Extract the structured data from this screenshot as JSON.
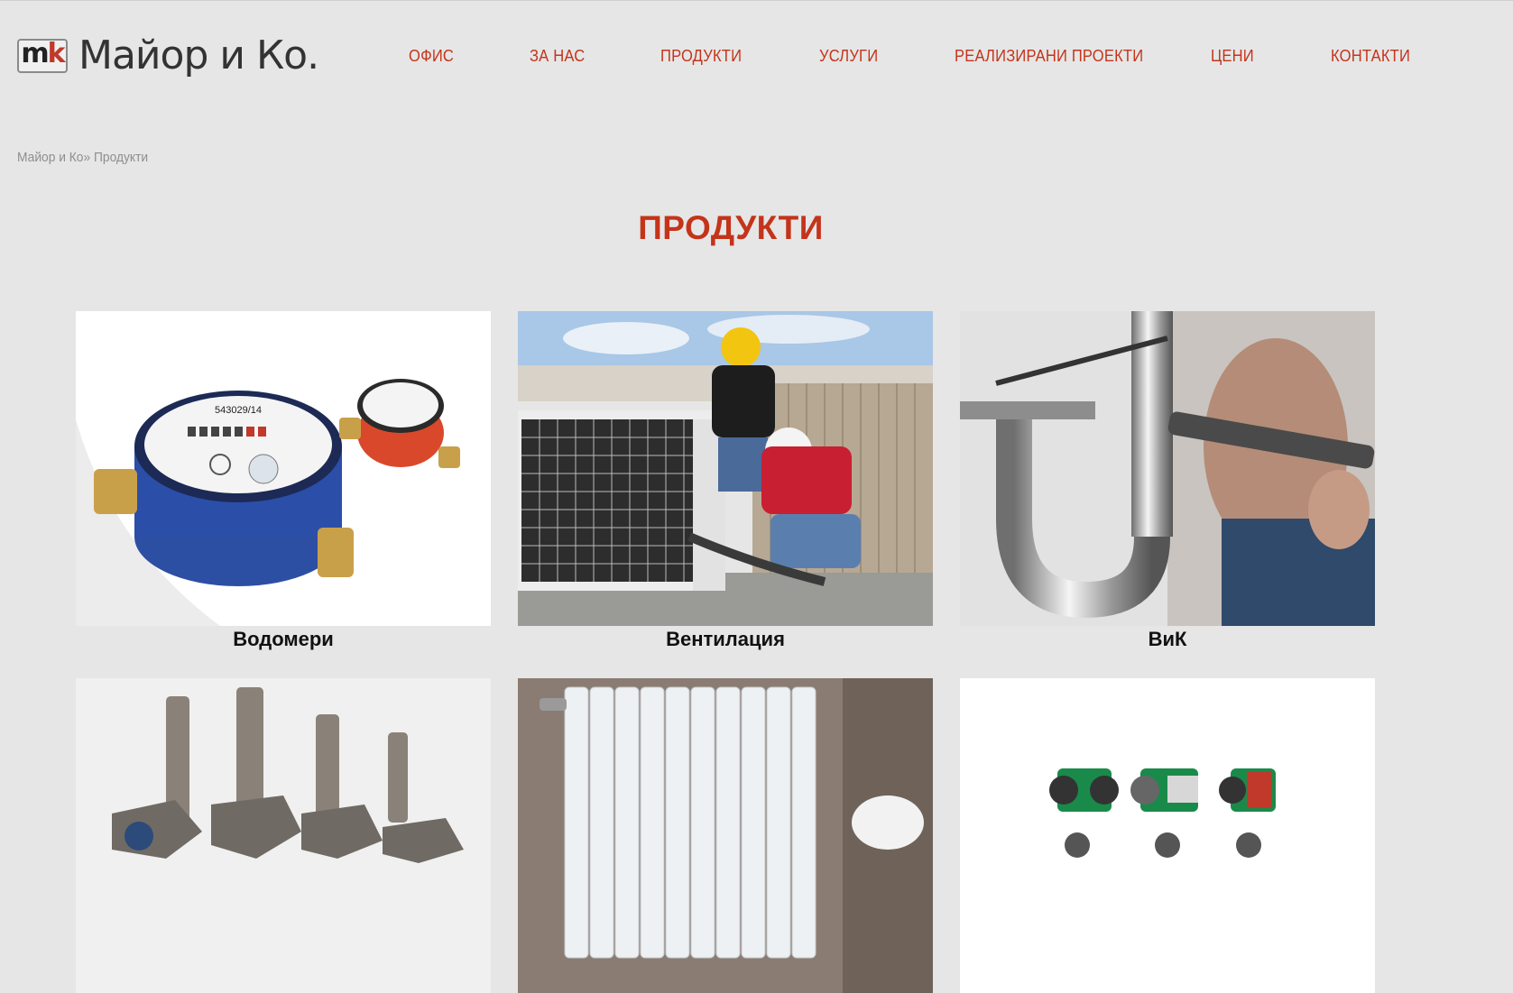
{
  "brand": {
    "logo_mark": "mk",
    "logo_text": "Майор и Ко."
  },
  "nav": {
    "items": [
      {
        "label": "ОФИС"
      },
      {
        "label": "ЗА НАС"
      },
      {
        "label": "ПРОДУКТИ"
      },
      {
        "label": "УСЛУГИ"
      },
      {
        "label": "РЕАЛИЗИРАНИ ПРОЕКТИ"
      },
      {
        "label": "ЦЕНИ"
      },
      {
        "label": "КОНТАКТИ"
      }
    ]
  },
  "breadcrumb": "Майор и Ко» Продукти",
  "page_title": "ПРОДУКТИ",
  "products": [
    {
      "label": "Водомери"
    },
    {
      "label": "Вентилация"
    },
    {
      "label": "ВиК"
    },
    {
      "label": ""
    },
    {
      "label": ""
    },
    {
      "label": ""
    }
  ],
  "colors": {
    "accent": "#c4341a",
    "background": "#e6e6e6"
  }
}
